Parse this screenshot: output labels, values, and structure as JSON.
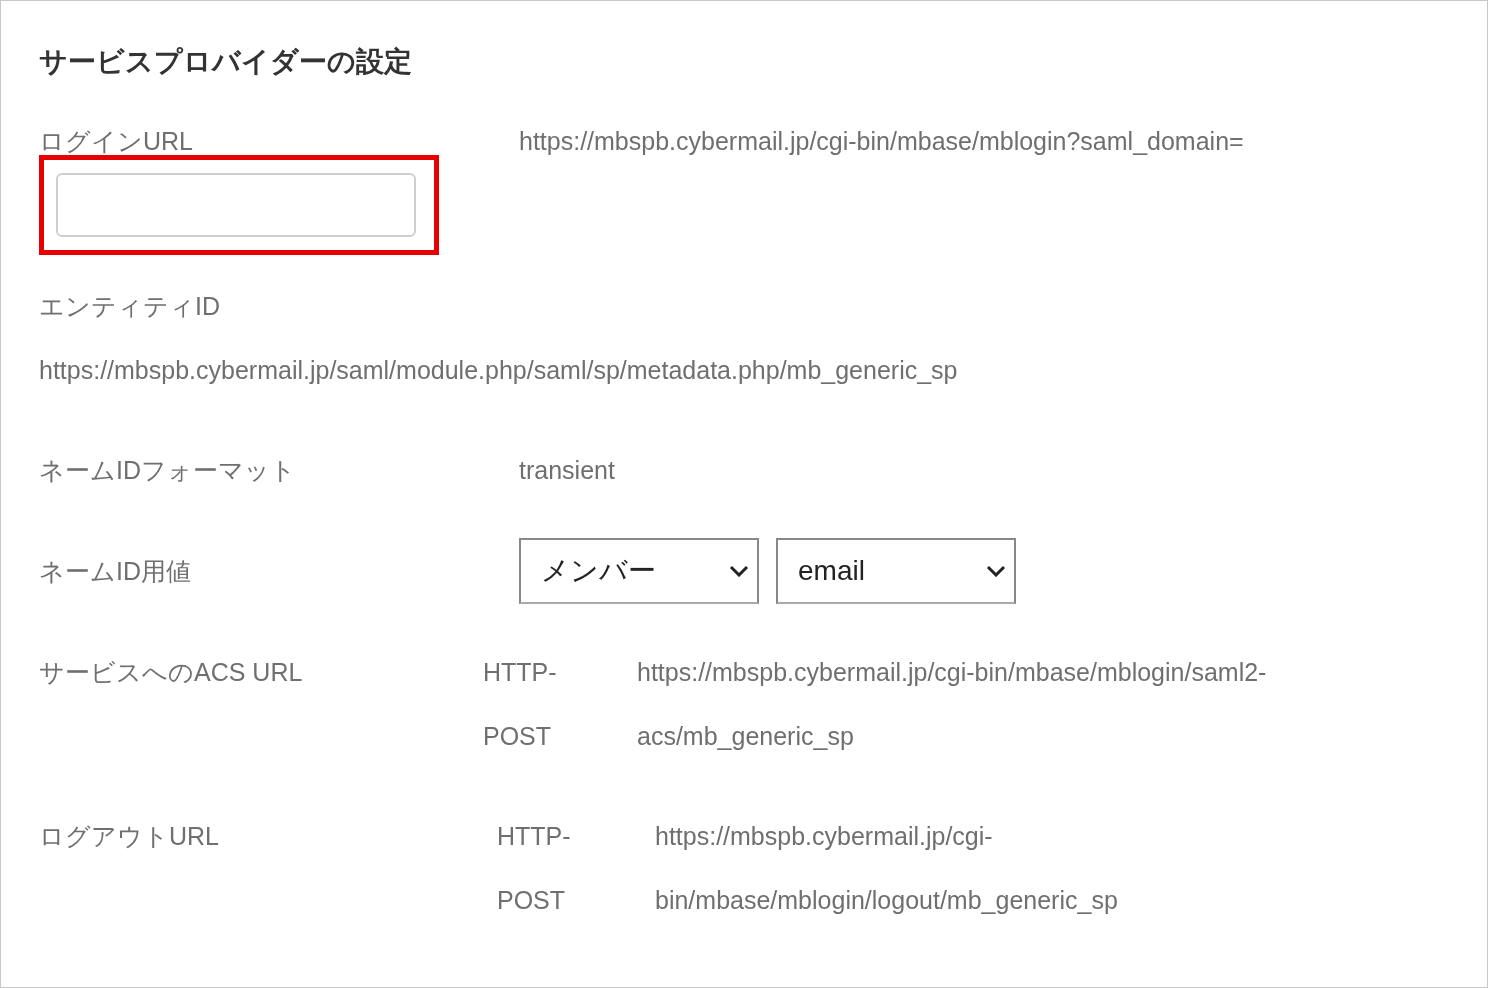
{
  "title": "サービスプロバイダーの設定",
  "login_url": {
    "label": "ログインURL",
    "value": "https://mbspb.cybermail.jp/cgi-bin/mbase/mblogin?saml_domain=",
    "highlighted": true
  },
  "entity_id": {
    "label": "エンティティID",
    "value": "https://mbspb.cybermail.jp/saml/module.php/saml/sp/metadata.php/mb_generic_sp"
  },
  "name_id_format": {
    "label": "ネームIDフォーマット",
    "value": "transient"
  },
  "name_id_value": {
    "label": "ネームID用値",
    "selects": [
      "メンバー",
      "email"
    ]
  },
  "endpoints": [
    {
      "label": "サービスへのACS URL",
      "binding": "HTTP-POST",
      "url": "https://mbspb.cybermail.jp/cgi-bin/mbase/mblogin/saml2-acs/mb_generic_sp"
    },
    {
      "label": "ログアウトURL",
      "binding": "HTTP-POST",
      "url": "https://mbspb.cybermail.jp/cgi-bin/mbase/mblogin/logout/mb_generic_sp"
    }
  ]
}
